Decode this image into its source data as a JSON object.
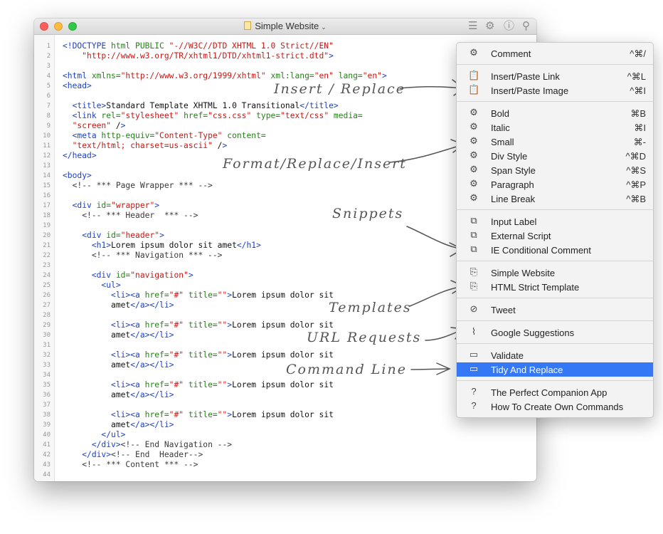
{
  "window": {
    "title": "Simple Website",
    "title_chevron": "⌄"
  },
  "toolbar": {
    "icons": [
      "menu-lines-icon",
      "gear-icon",
      "info-icon",
      "location-pin-icon"
    ]
  },
  "editor": {
    "lines": [
      {
        "n": "1",
        "text": "<!DOCTYPE html PUBLIC \"-//W3C//DTD XHTML 1.0 Strict//EN\""
      },
      {
        "n": "2",
        "text": "    \"http://www.w3.org/TR/xhtml1/DTD/xhtml1-strict.dtd\">"
      },
      {
        "n": "3",
        "text": ""
      },
      {
        "n": "4",
        "text": "<html xmlns=\"http://www.w3.org/1999/xhtml\" xml:lang=\"en\" lang=\"en\">"
      },
      {
        "n": "5",
        "text": "<head>"
      },
      {
        "n": "6",
        "text": ""
      },
      {
        "n": "7",
        "text": "  <title>Standard Template XHTML 1.0 Transitional</title>"
      },
      {
        "n": "8",
        "text": "  <link rel=\"stylesheet\" href=\"css.css\" type=\"text/css\" media="
      },
      {
        "n": "9",
        "text": "  \"screen\" />"
      },
      {
        "n": "10",
        "text": "  <meta http-equiv=\"Content-Type\" content="
      },
      {
        "n": "11",
        "text": "  \"text/html; charset=us-ascii\" />"
      },
      {
        "n": "12",
        "text": "</head>"
      },
      {
        "n": "13",
        "text": ""
      },
      {
        "n": "14",
        "text": "<body>"
      },
      {
        "n": "15",
        "text": "  <!-- *** Page Wrapper *** -->"
      },
      {
        "n": "16",
        "text": ""
      },
      {
        "n": "17",
        "text": "  <div id=\"wrapper\">"
      },
      {
        "n": "18",
        "text": "    <!-- *** Header  *** -->"
      },
      {
        "n": "19",
        "text": ""
      },
      {
        "n": "20",
        "text": "    <div id=\"header\">"
      },
      {
        "n": "21",
        "text": "      <h1>Lorem ipsum dolor sit amet</h1>"
      },
      {
        "n": "22",
        "text": "      <!-- *** Navigation *** -->"
      },
      {
        "n": "23",
        "text": ""
      },
      {
        "n": "24",
        "text": "      <div id=\"navigation\">"
      },
      {
        "n": "25",
        "text": "        <ul>"
      },
      {
        "n": "26",
        "text": "          <li><a href=\"#\" title=\"\">Lorem ipsum dolor sit"
      },
      {
        "n": "27",
        "text": "          amet</a></li>"
      },
      {
        "n": "28",
        "text": ""
      },
      {
        "n": "29",
        "text": "          <li><a href=\"#\" title=\"\">Lorem ipsum dolor sit"
      },
      {
        "n": "30",
        "text": "          amet</a></li>"
      },
      {
        "n": "31",
        "text": ""
      },
      {
        "n": "32",
        "text": "          <li><a href=\"#\" title=\"\">Lorem ipsum dolor sit"
      },
      {
        "n": "33",
        "text": "          amet</a></li>"
      },
      {
        "n": "34",
        "text": ""
      },
      {
        "n": "35",
        "text": "          <li><a href=\"#\" title=\"\">Lorem ipsum dolor sit"
      },
      {
        "n": "36",
        "text": "          amet</a></li>"
      },
      {
        "n": "37",
        "text": ""
      },
      {
        "n": "38",
        "text": "          <li><a href=\"#\" title=\"\">Lorem ipsum dolor sit"
      },
      {
        "n": "39",
        "text": "          amet</a></li>"
      },
      {
        "n": "40",
        "text": "        </ul>"
      },
      {
        "n": "41",
        "text": "      </div><!-- End Navigation -->"
      },
      {
        "n": "42",
        "text": "    </div><!-- End  Header-->"
      },
      {
        "n": "43",
        "text": "    <!-- *** Content *** -->"
      },
      {
        "n": "44",
        "text": ""
      }
    ]
  },
  "menu": {
    "groups": [
      [
        {
          "icon": "gear-icon",
          "label": "Comment",
          "shortcut": "^⌘/"
        }
      ],
      [
        {
          "icon": "clipboard-icon",
          "label": "Insert/Paste Link",
          "shortcut": "^⌘L"
        },
        {
          "icon": "clipboard-icon",
          "label": "Insert/Paste Image",
          "shortcut": "^⌘I"
        }
      ],
      [
        {
          "icon": "gear-icon",
          "label": "Bold",
          "shortcut": "⌘B"
        },
        {
          "icon": "gear-icon",
          "label": "Italic",
          "shortcut": "⌘I"
        },
        {
          "icon": "gear-icon",
          "label": "Small",
          "shortcut": "⌘-"
        },
        {
          "icon": "gear-icon",
          "label": "Div Style",
          "shortcut": "^⌘D"
        },
        {
          "icon": "gear-icon",
          "label": "Span Style",
          "shortcut": "^⌘S"
        },
        {
          "icon": "gear-icon",
          "label": "Paragraph",
          "shortcut": "^⌘P"
        },
        {
          "icon": "gear-icon",
          "label": "Line Break",
          "shortcut": "^⌘B"
        }
      ],
      [
        {
          "icon": "puzzle-icon",
          "label": "Input Label",
          "shortcut": ""
        },
        {
          "icon": "puzzle-icon",
          "label": "External Script",
          "shortcut": ""
        },
        {
          "icon": "puzzle-icon",
          "label": "IE Conditional Comment",
          "shortcut": ""
        }
      ],
      [
        {
          "icon": "template-icon",
          "label": "Simple Website",
          "shortcut": ""
        },
        {
          "icon": "template-icon",
          "label": "HTML Strict Template",
          "shortcut": ""
        }
      ],
      [
        {
          "icon": "compass-icon",
          "label": "Tweet",
          "shortcut": ""
        }
      ],
      [
        {
          "icon": "paperclip-icon",
          "label": "Google Suggestions",
          "shortcut": ""
        }
      ],
      [
        {
          "icon": "terminal-icon",
          "label": "Validate",
          "shortcut": ""
        },
        {
          "icon": "terminal-icon",
          "label": "Tidy And Replace",
          "shortcut": "",
          "selected": true
        }
      ],
      [
        {
          "icon": "question-icon",
          "label": "The Perfect Companion App",
          "shortcut": ""
        },
        {
          "icon": "question-icon",
          "label": "How To Create Own Commands",
          "shortcut": ""
        }
      ]
    ]
  },
  "annotations": {
    "insert_replace": "Insert / Replace",
    "format_replace_insert": "Format/Replace/Insert",
    "snippets": "Snippets",
    "templates": "Templates",
    "url_requests": "URL  Requests",
    "command_line": "Command  Line"
  },
  "colors": {
    "selection": "#3478f6",
    "tag": "#1e40c6",
    "string": "#c41a16"
  }
}
